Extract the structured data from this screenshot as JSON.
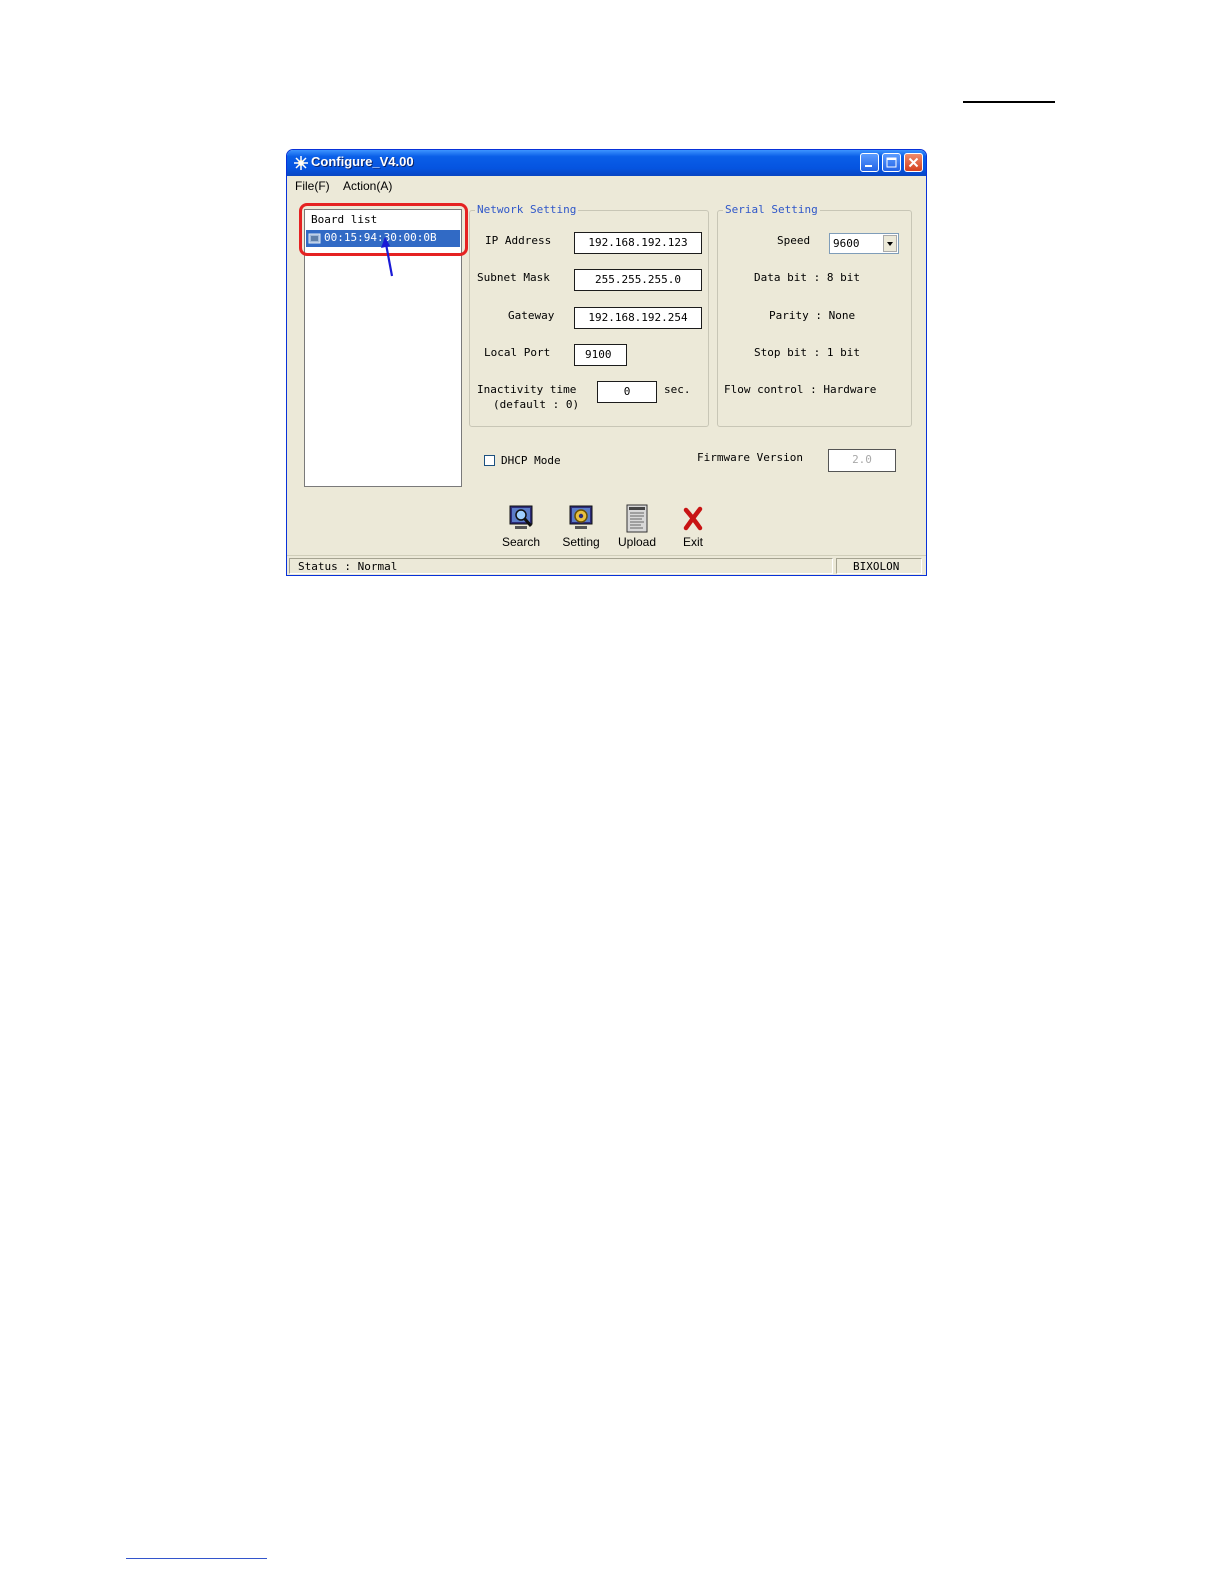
{
  "window": {
    "title": "Configure_V4.00"
  },
  "menu": {
    "file": "File(F)",
    "action": "Action(A)"
  },
  "board_list": {
    "header": "Board list",
    "items": [
      "00:15:94:30:00:0B"
    ]
  },
  "network": {
    "title": "Network Setting",
    "ip_label": "IP Address",
    "ip_value": "192.168.192.123",
    "subnet_label": "Subnet Mask",
    "subnet_value": "255.255.255.0",
    "gateway_label": "Gateway",
    "gateway_value": "192.168.192.254",
    "port_label": "Local Port",
    "port_value": "9100",
    "inactivity_label": "Inactivity time",
    "inactivity_default": "(default : 0)",
    "inactivity_value": "0",
    "inactivity_unit": "sec."
  },
  "serial": {
    "title": "Serial Setting",
    "speed_label": "Speed",
    "speed_value": "9600",
    "data_bit": "Data bit : 8 bit",
    "parity": "Parity : None",
    "stop_bit": "Stop bit : 1 bit",
    "flow_control": "Flow control : Hardware"
  },
  "dhcp": {
    "label": "DHCP Mode",
    "checked": false
  },
  "firmware": {
    "label": "Firmware Version",
    "value": "2.0"
  },
  "toolbar": {
    "search": "Search",
    "setting": "Setting",
    "upload": "Upload",
    "exit": "Exit"
  },
  "status": {
    "text": "Status : Normal",
    "vendor": "BIXOLON"
  },
  "colors": {
    "titlebar": "#0554e0",
    "selection": "#316ac5",
    "highlight": "#e52222",
    "arrow": "#1a1ad6",
    "group_title": "#2f57c9"
  }
}
